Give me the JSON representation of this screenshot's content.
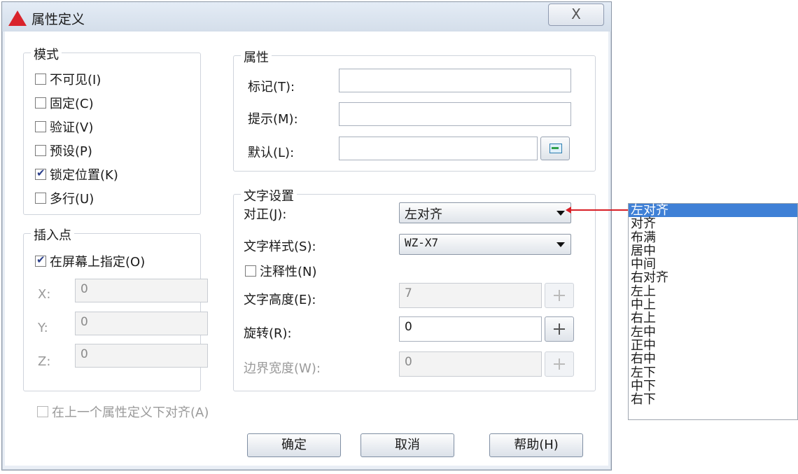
{
  "title": "属性定义",
  "close_symbol": "X",
  "mode": {
    "title": "模式",
    "items": [
      {
        "label": "不可见(I)",
        "checked": false
      },
      {
        "label": "固定(C)",
        "checked": false
      },
      {
        "label": "验证(V)",
        "checked": false
      },
      {
        "label": "预设(P)",
        "checked": false
      },
      {
        "label": "锁定位置(K)",
        "checked": true
      },
      {
        "label": "多行(U)",
        "checked": false
      }
    ]
  },
  "insert_point": {
    "title": "插入点",
    "on_screen_label": "在屏幕上指定(O)",
    "x_label": "X:",
    "x_value": "0",
    "y_label": "Y:",
    "y_value": "0",
    "z_label": "Z:",
    "z_value": "0"
  },
  "attribute": {
    "title": "属性",
    "tag_label": "标记(T):",
    "tag_value": "",
    "prompt_label": "提示(M):",
    "prompt_value": "",
    "default_label": "默认(L):",
    "default_value": ""
  },
  "text_settings": {
    "title": "文字设置",
    "justify_label": "对正(J):",
    "justify_value": "左对齐",
    "style_label": "文字样式(S):",
    "style_value": "WZ-X7",
    "annotative_label": "注释性(N)",
    "height_label": "文字高度(E):",
    "height_value": "7",
    "rotation_label": "旋转(R):",
    "rotation_value": "0",
    "boundary_label": "边界宽度(W):",
    "boundary_value": "0"
  },
  "align_below_label": "在上一个属性定义下对齐(A)",
  "buttons": {
    "ok": "确定",
    "cancel": "取消",
    "help": "帮助(H)"
  },
  "justify_options": [
    "左对齐",
    "对齐",
    "布满",
    "居中",
    "中间",
    "右对齐",
    "左上",
    "中上",
    "右上",
    "左中",
    "正中",
    "右中",
    "左下",
    "中下",
    "右下"
  ],
  "colors": {
    "accent": "#3f80d6",
    "callout": "#d81f26"
  }
}
